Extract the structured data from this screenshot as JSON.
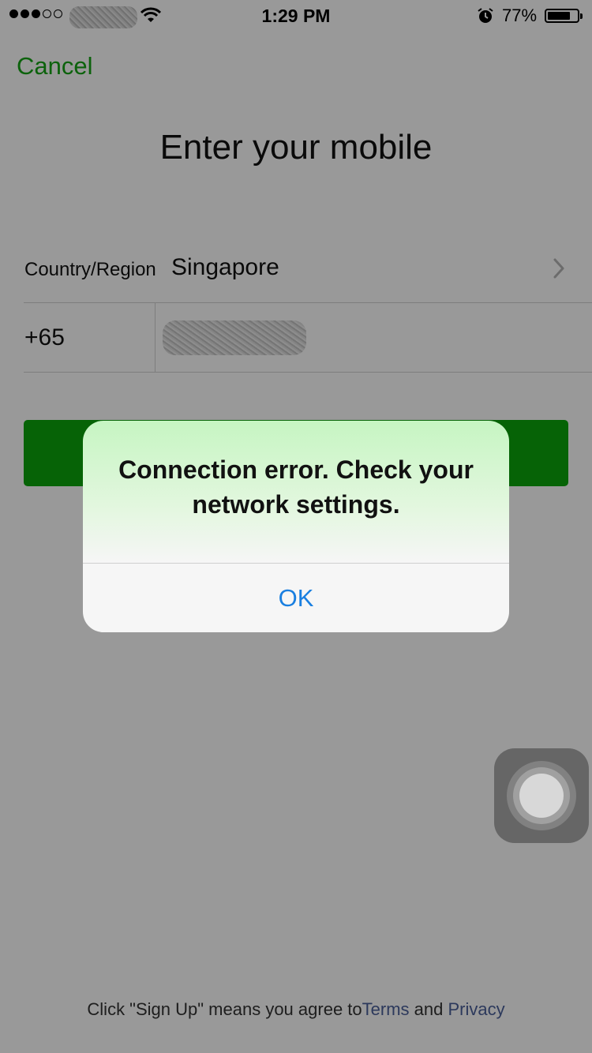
{
  "status_bar": {
    "time": "1:29 PM",
    "battery_percent": "77%",
    "battery_level": 0.77,
    "signal_bars_filled": 3,
    "signal_bars_total": 5
  },
  "nav": {
    "cancel_label": "Cancel"
  },
  "page": {
    "title": "Enter your mobile"
  },
  "form": {
    "country_label": "Country/Region",
    "country_value": "Singapore",
    "dial_code": "+65"
  },
  "footer": {
    "agreement_prefix": "Click \"Sign Up\" means you agree to",
    "terms_link": "Terms",
    "and_text": " and ",
    "privacy_link": "Privacy"
  },
  "alert": {
    "message": "Connection error. Check your network settings.",
    "ok_label": "OK"
  },
  "colors": {
    "accent_green": "#15a415",
    "button_green": "#0aa50a",
    "alert_button_blue": "#1a7fe0",
    "link_color": "#4a5f9a"
  }
}
